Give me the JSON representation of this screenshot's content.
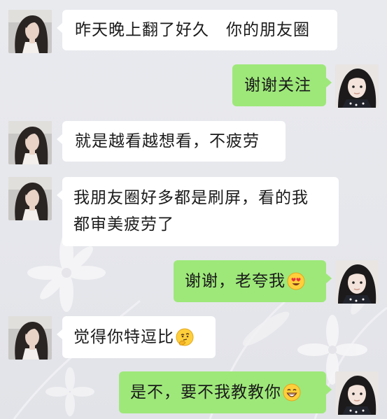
{
  "messages": [
    {
      "side": "in",
      "text": "昨天晚上翻了好久　你的朋友圈"
    },
    {
      "side": "out",
      "text": "谢谢关注"
    },
    {
      "side": "in",
      "text": "就是越看越想看，不疲劳"
    },
    {
      "side": "in",
      "lines": [
        "我朋友圈好多都是刷屏，看的我",
        "都审美疲劳了"
      ]
    },
    {
      "side": "out",
      "text": "谢谢，老夸我",
      "emoji": "heart-eyes-emoji"
    },
    {
      "side": "in",
      "text": "觉得你特逗比",
      "emoji": "thinking-emoji"
    },
    {
      "side": "out",
      "text": "是不，要不我教教你",
      "emoji": "grinning-emoji"
    }
  ],
  "colors": {
    "background": "#e6e7ec",
    "incoming_bubble": "#ffffff",
    "outgoing_bubble": "#9ee87a",
    "text": "#1a1a1a"
  }
}
